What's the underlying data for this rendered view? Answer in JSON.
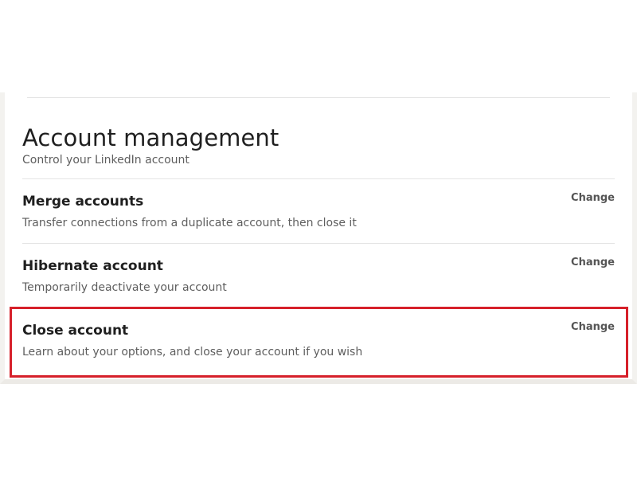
{
  "section": {
    "title": "Account management",
    "subtitle": "Control your LinkedIn account"
  },
  "rows": [
    {
      "title": "Merge accounts",
      "description": "Transfer connections from a duplicate account, then close it",
      "action": "Change"
    },
    {
      "title": "Hibernate account",
      "description": "Temporarily deactivate your account",
      "action": "Change"
    },
    {
      "title": "Close account",
      "description": "Learn about your options, and close your account if you wish",
      "action": "Change"
    }
  ],
  "highlight": {
    "target": "close-account-row",
    "color": "#d6202a"
  }
}
